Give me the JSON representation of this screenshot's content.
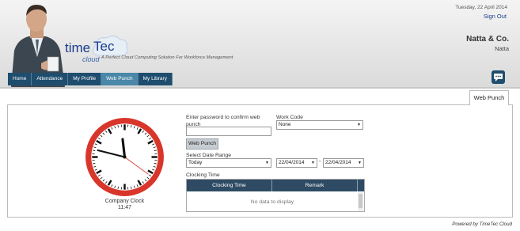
{
  "header": {
    "date": "Tuesday, 22 April 2014",
    "sign_out": "Sign Out",
    "company": "Natta & Co.",
    "user": "Natta"
  },
  "logo": {
    "time": "time",
    "tec": "Tec",
    "cloud": "cloud",
    "tagline": "A Perfect Cloud Computing Solution For Workforce Management"
  },
  "nav": {
    "items": [
      {
        "label": "Home"
      },
      {
        "label": "Attendance"
      },
      {
        "label": "My Profile"
      },
      {
        "label": "Web Punch"
      },
      {
        "label": "My Library"
      }
    ],
    "active": "Web Punch"
  },
  "tab": {
    "label": "Web Punch"
  },
  "clock": {
    "label": "Company Clock",
    "time": "11:47",
    "hour": 11,
    "minute": 47,
    "second": 21
  },
  "form": {
    "password_label": "Enter password to confirm web punch",
    "password_value": "",
    "work_code_label": "Work Code",
    "work_code_value": "None",
    "punch_button": "Web Punch",
    "date_range_label": "Select Date Range",
    "date_range_value": "Today",
    "from_date": "22/04/2014",
    "to_date": "22/04/2014",
    "separator": "-",
    "clocking_label": "Clocking Time"
  },
  "grid": {
    "columns": [
      "Clocking Time",
      "Remark"
    ],
    "empty_text": "No data to display"
  },
  "footer": {
    "powered": "Powered by TimeTec Cloud"
  },
  "colors": {
    "nav": "#1e4d6e",
    "nav_active": "#4a87a8",
    "clock_rim": "#d9362b",
    "grid_head": "#2f4b64"
  }
}
